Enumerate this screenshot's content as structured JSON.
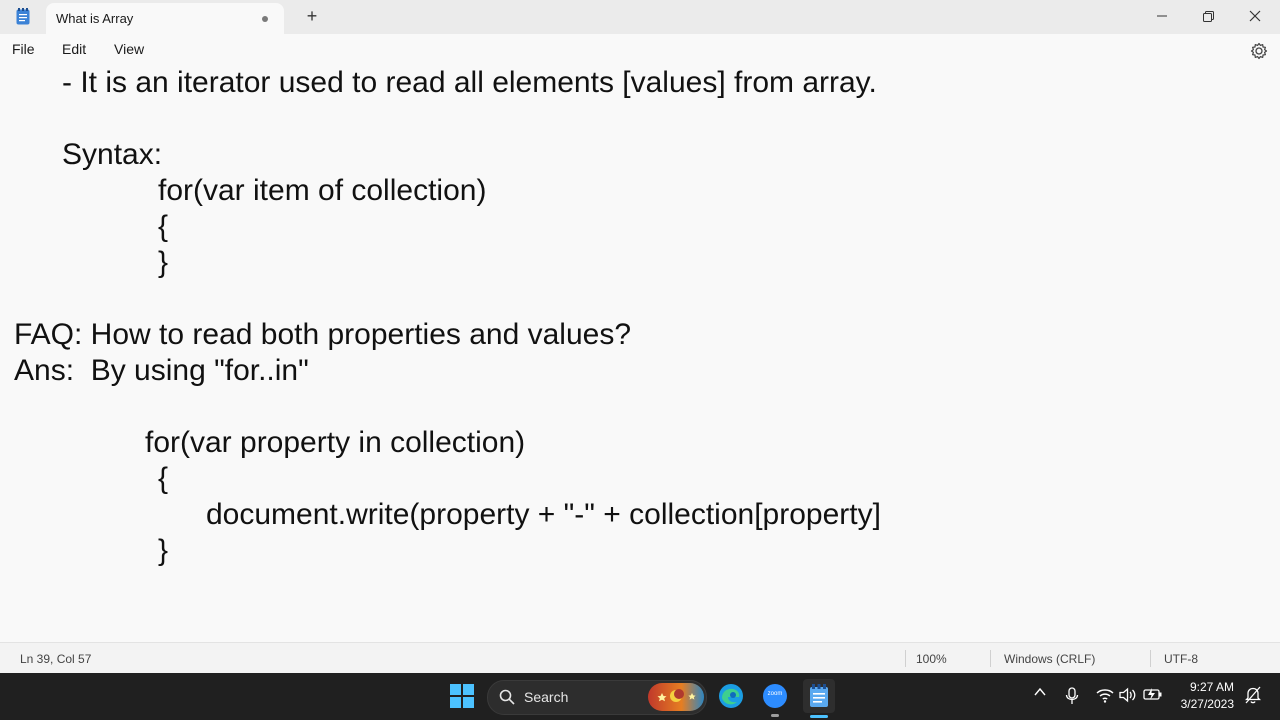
{
  "window": {
    "tab_title": "What is Array",
    "new_tab": "+"
  },
  "menu": {
    "file": "File",
    "edit": "Edit",
    "view": "View"
  },
  "editor": {
    "lines": [
      "- It is an iterator used to read all elements [values] from array.",
      "Syntax:",
      "for(var item of collection)",
      "{",
      "}",
      "FAQ: How to read both properties and values?",
      "Ans:  By using \"for..in\"",
      "for(var property in collection)",
      "{",
      "document.write(property + \"-\" + collection[property]",
      "}"
    ]
  },
  "status": {
    "position": "Ln 39, Col 57",
    "zoom": "100%",
    "line_ending": "Windows (CRLF)",
    "encoding": "UTF-8"
  },
  "taskbar": {
    "search_label": "Search",
    "zoom_label": "zoom",
    "time": "9:27 AM",
    "date": "3/27/2023"
  },
  "icons": {
    "app": "notepad-icon",
    "minimize": "minimize-icon",
    "maximize": "restore-icon",
    "close": "close-icon",
    "settings": "gear-icon"
  },
  "colors": {
    "titlebar": "#ebebeb",
    "editor_bg": "#f9f9f9",
    "taskbar": "#202020",
    "notepad_accent": "#3b82d6"
  }
}
